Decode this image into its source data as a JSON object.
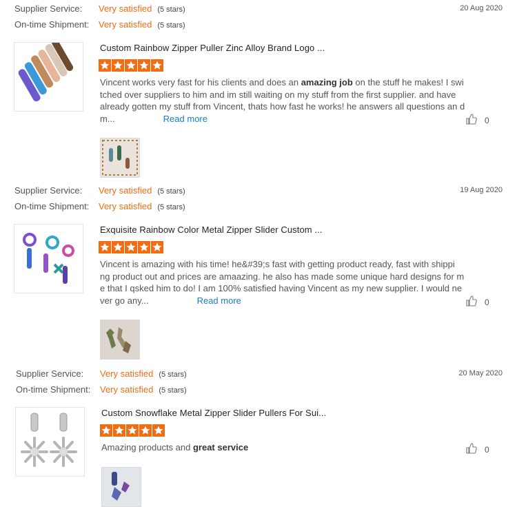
{
  "reviews": [
    {
      "supplier_label": "Supplier Service:",
      "supplier_value": "Very satisfied",
      "supplier_stars": "(5 stars)",
      "shipment_label": "On-time Shipment:",
      "shipment_value": "Very satisfied",
      "shipment_stars": "(5 stars)",
      "date": "20 Aug 2020",
      "product_title": "Custom Rainbow Zipper Puller Zinc Alloy Brand Logo ...",
      "rating": 5,
      "text_before": "Vincent works very fast for his clients and does an ",
      "text_bold": "amazing job",
      "text_after": " on the stuff he makes! I swi tched over suppliers to him and im still waiting on my stuff from the first supplier. and have already gotten my stuff from Vincent, thats how fast he works! he answers all questions an d m...",
      "read_more": "Read more",
      "like_count": "0"
    },
    {
      "supplier_label": "Supplier Service:",
      "supplier_value": "Very satisfied",
      "supplier_stars": "(5 stars)",
      "shipment_label": "On-time Shipment:",
      "shipment_value": "Very satisfied",
      "shipment_stars": "(5 stars)",
      "date": "19 Aug 2020",
      "product_title": "Exquisite Rainbow Color Metal Zipper Slider Custom ...",
      "rating": 5,
      "text_before": "Vincent is amazing with his time! he&#39;s fast with getting product ready, fast with shippi ng product out and prices are amaazing. he also has made some unique hard designs for m e that I qsked him to do! I am 100% satisfied having Vincent as my new supplier. I would ne ver go any...",
      "text_bold": "",
      "text_after": "",
      "read_more": "Read more",
      "like_count": "0"
    },
    {
      "supplier_label": "Supplier Service:",
      "supplier_value": "Very satisfied",
      "supplier_stars": "(5 stars)",
      "shipment_label": "On-time Shipment:",
      "shipment_value": "Very satisfied",
      "shipment_stars": "(5 stars)",
      "date": "20 May 2020",
      "product_title": "Custom Snowflake Metal Zipper Slider Pullers For Sui...",
      "rating": 5,
      "text_before": "Amazing products and ",
      "text_bold": "great service",
      "text_after": "",
      "read_more": "",
      "like_count": "0"
    }
  ],
  "colors": {
    "accent": "#f26c11",
    "link": "#1a7bc4"
  },
  "icons": {
    "like": "thumbs-up-icon",
    "star": "star-icon"
  }
}
